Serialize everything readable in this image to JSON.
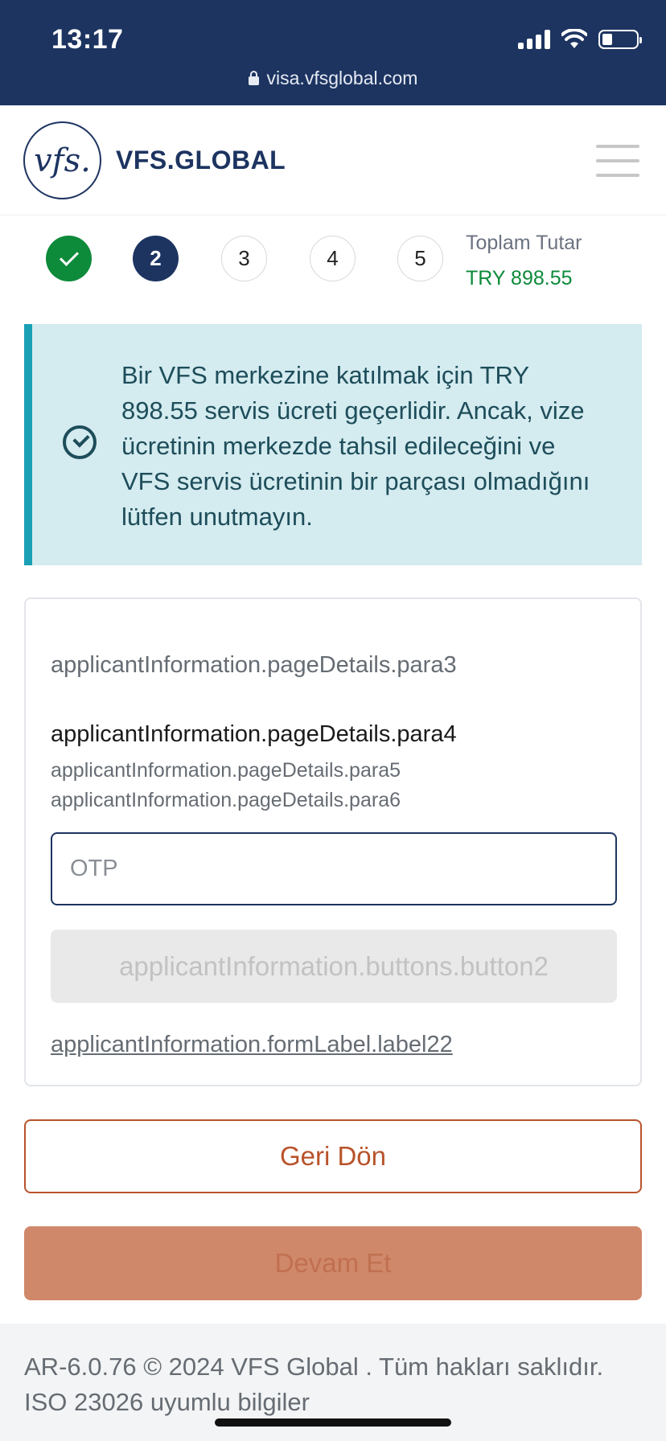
{
  "status_bar": {
    "time": "13:17",
    "url": "visa.vfsglobal.com",
    "icons": [
      "signal-icon",
      "wifi-icon",
      "battery-icon"
    ]
  },
  "header": {
    "logo_mark": "vfs.",
    "logo_text": "VFS.GLOBAL",
    "menu_icon": "hamburger-menu-icon"
  },
  "steps": {
    "items": [
      {
        "label": "",
        "state": "completed"
      },
      {
        "label": "2",
        "state": "current"
      },
      {
        "label": "3",
        "state": "upcoming"
      },
      {
        "label": "4",
        "state": "upcoming"
      },
      {
        "label": "5",
        "state": "upcoming"
      }
    ],
    "total_label": "Toplam Tutar",
    "total_value": "TRY 898.55"
  },
  "banner": {
    "icon": "check-circle-icon",
    "text": "Bir VFS merkezine katılmak için TRY 898.55 servis ücreti geçerlidir. Ancak, vize ücretinin merkezde tahsil edileceğini ve VFS servis ücretinin bir parçası olmadığını lütfen unutmayın."
  },
  "card": {
    "para3": "applicantInformation.pageDetails.para3",
    "para4": "applicantInformation.pageDetails.para4",
    "para5": "applicantInformation.pageDetails.para5",
    "para6": "applicantInformation.pageDetails.para6",
    "otp_placeholder": "OTP",
    "otp_value": "",
    "button2_label": "applicantInformation.buttons.button2",
    "label22": "applicantInformation.formLabel.label22"
  },
  "actions": {
    "back_label": "Geri Dön",
    "continue_label": "Devam Et"
  },
  "footer": {
    "text": "AR-6.0.76 © 2024 VFS Global . Tüm hakları saklıdır. ISO 23026 uyumlu bilgiler"
  },
  "colors": {
    "navy": "#1d3461",
    "green": "#0d8a3a",
    "teal_accent": "#1aa0b4",
    "banner_bg": "#d4ebef",
    "orange": "#b8532b",
    "orange_disabled": "#d0886a"
  }
}
